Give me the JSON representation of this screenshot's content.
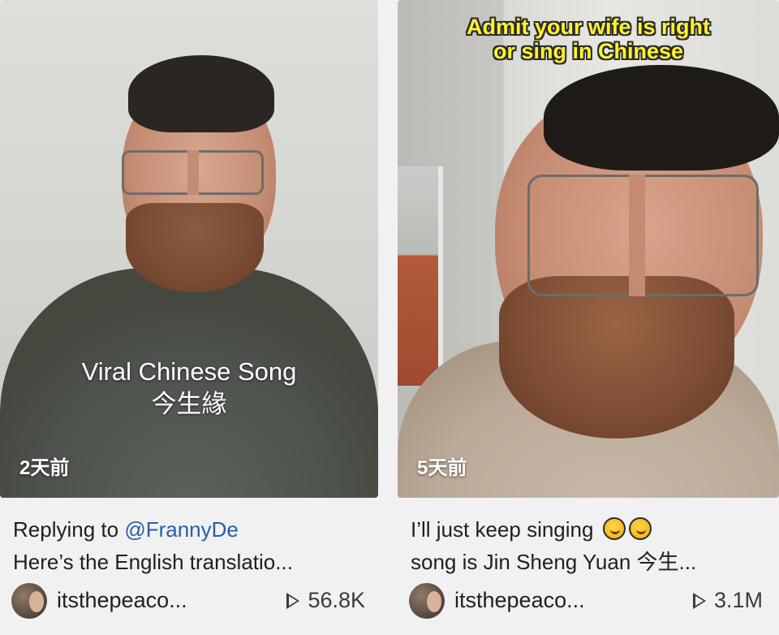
{
  "cards": [
    {
      "overlay_title": "Viral Chinese Song",
      "overlay_subtitle": "今生緣",
      "time_badge": "2天前",
      "description": {
        "line1_prefix": "Replying to ",
        "line1_mention": "@FrannyDe",
        "line2": "Here’s the English translatio..."
      },
      "author": "itsthepeaco...",
      "views": "56.8K"
    },
    {
      "top_caption_line1": "Admit your wife is right",
      "top_caption_line2": "or sing in Chinese",
      "time_badge": "5天前",
      "description": {
        "line1": "I’ll just keep singing",
        "line2": "song is Jin Sheng Yuan 今生..."
      },
      "author": "itsthepeaco...",
      "views": "3.1M"
    }
  ]
}
